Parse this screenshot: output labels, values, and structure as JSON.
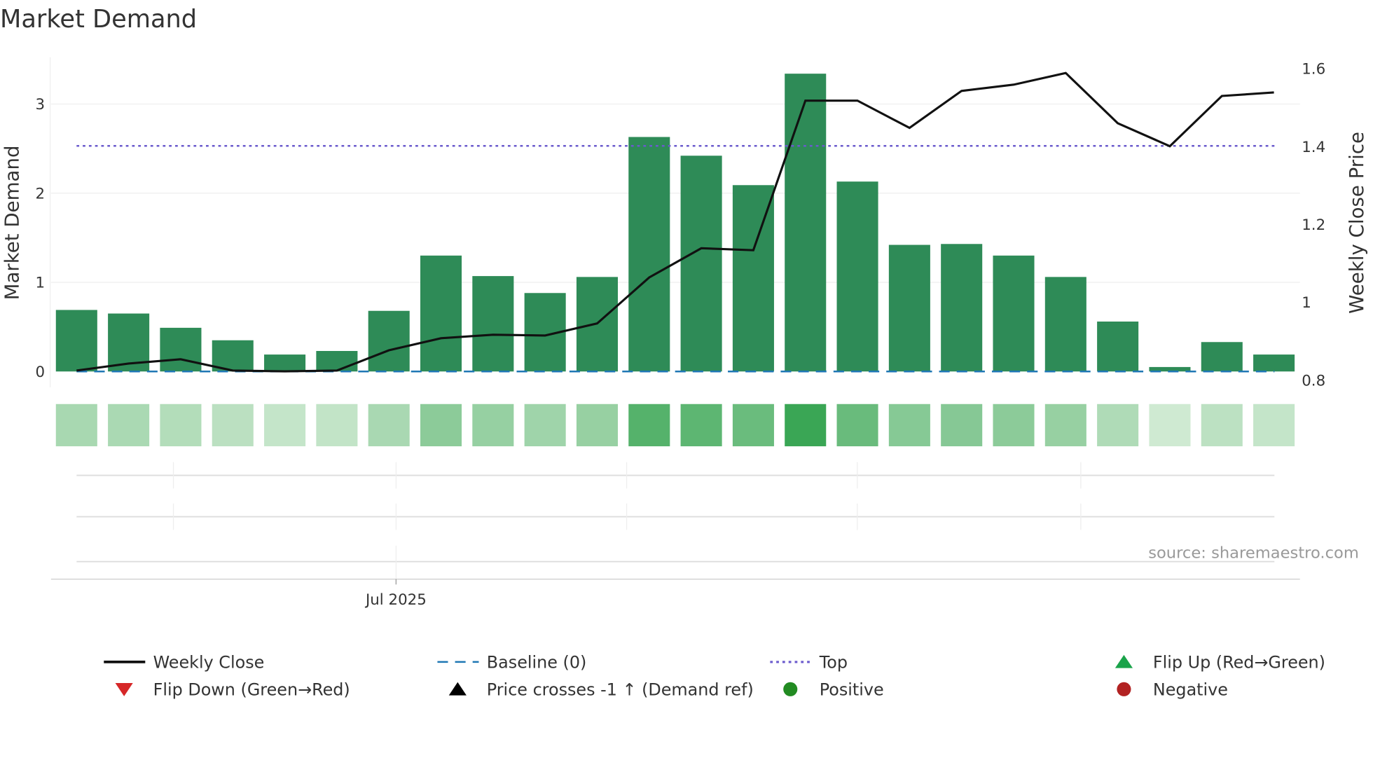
{
  "title": "Market Demand",
  "source": "source: sharemaestro.com",
  "chart_data": {
    "type": "bar",
    "title": "Market Demand",
    "ylabel": "Market Demand",
    "y2label": "Weekly Close Price",
    "ylim": [
      0,
      3.5
    ],
    "y2lim": [
      0.8,
      1.62
    ],
    "yticks": [
      "0",
      "1",
      "2",
      "3"
    ],
    "y2ticks": [
      "0.8",
      "1",
      "1.2",
      "1.4",
      "1.6"
    ],
    "xtick_label": "Jul 2025",
    "grid": true,
    "legend_placement": "bottom",
    "series": [
      {
        "name": "Market Demand",
        "type": "bar",
        "color": "#2e8b57",
        "values": [
          0.69,
          0.65,
          0.49,
          0.35,
          0.19,
          0.23,
          0.68,
          1.3,
          1.07,
          0.88,
          1.06,
          2.63,
          2.42,
          2.09,
          3.34,
          2.13,
          1.42,
          1.43,
          1.3,
          1.06,
          0.56,
          0.05,
          0.33,
          0.19
        ]
      },
      {
        "name": "Weekly Close",
        "type": "line",
        "axis": "right",
        "color": "#111111",
        "values": [
          0.825,
          0.843,
          0.854,
          0.825,
          0.823,
          0.825,
          0.877,
          0.908,
          0.917,
          0.915,
          0.946,
          1.064,
          1.139,
          1.134,
          1.518,
          1.518,
          1.448,
          1.543,
          1.559,
          1.589,
          1.46,
          1.401,
          1.53,
          1.539
        ]
      },
      {
        "name": "Baseline (0)",
        "type": "hline",
        "value": 0,
        "color": "#1f77b4"
      },
      {
        "name": "Top",
        "type": "hline",
        "value": 2.53,
        "color": "#6a5acd"
      }
    ],
    "legend": [
      {
        "label": "Weekly Close",
        "symbol": "line",
        "color": "#111111"
      },
      {
        "label": "Baseline (0)",
        "symbol": "dash",
        "color": "#1f77b4"
      },
      {
        "label": "Top",
        "symbol": "dot",
        "color": "#6a5acd"
      },
      {
        "label": "Flip Up (Red→Green)",
        "symbol": "triangle-up",
        "color": "#1aa34a"
      },
      {
        "label": "Flip Down (Green→Red)",
        "symbol": "triangle-down",
        "color": "#d62728"
      },
      {
        "label": "Price crosses -1 ↑ (Demand ref)",
        "symbol": "triangle-up",
        "color": "#000000"
      },
      {
        "label": "Positive",
        "symbol": "circle",
        "color": "#228b22"
      },
      {
        "label": "Negative",
        "symbol": "circle",
        "color": "#b22222"
      }
    ]
  }
}
